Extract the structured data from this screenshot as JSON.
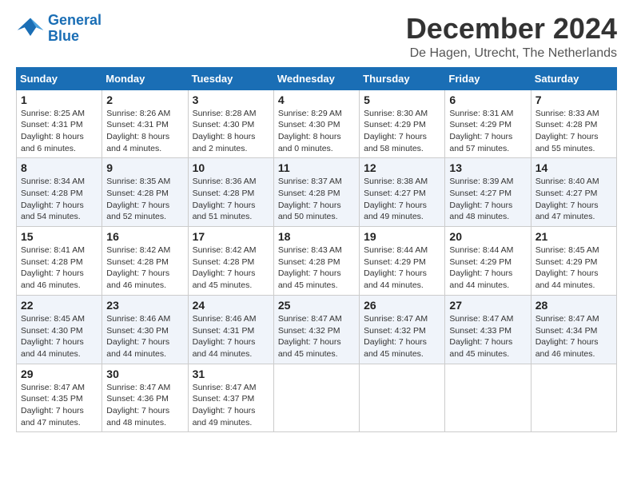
{
  "header": {
    "logo_line1": "General",
    "logo_line2": "Blue",
    "month_year": "December 2024",
    "location": "De Hagen, Utrecht, The Netherlands"
  },
  "days_of_week": [
    "Sunday",
    "Monday",
    "Tuesday",
    "Wednesday",
    "Thursday",
    "Friday",
    "Saturday"
  ],
  "weeks": [
    [
      {
        "day": "1",
        "sunrise": "8:25 AM",
        "sunset": "4:31 PM",
        "daylight": "8 hours and 6 minutes."
      },
      {
        "day": "2",
        "sunrise": "8:26 AM",
        "sunset": "4:31 PM",
        "daylight": "8 hours and 4 minutes."
      },
      {
        "day": "3",
        "sunrise": "8:28 AM",
        "sunset": "4:30 PM",
        "daylight": "8 hours and 2 minutes."
      },
      {
        "day": "4",
        "sunrise": "8:29 AM",
        "sunset": "4:30 PM",
        "daylight": "8 hours and 0 minutes."
      },
      {
        "day": "5",
        "sunrise": "8:30 AM",
        "sunset": "4:29 PM",
        "daylight": "7 hours and 58 minutes."
      },
      {
        "day": "6",
        "sunrise": "8:31 AM",
        "sunset": "4:29 PM",
        "daylight": "7 hours and 57 minutes."
      },
      {
        "day": "7",
        "sunrise": "8:33 AM",
        "sunset": "4:28 PM",
        "daylight": "7 hours and 55 minutes."
      }
    ],
    [
      {
        "day": "8",
        "sunrise": "8:34 AM",
        "sunset": "4:28 PM",
        "daylight": "7 hours and 54 minutes."
      },
      {
        "day": "9",
        "sunrise": "8:35 AM",
        "sunset": "4:28 PM",
        "daylight": "7 hours and 52 minutes."
      },
      {
        "day": "10",
        "sunrise": "8:36 AM",
        "sunset": "4:28 PM",
        "daylight": "7 hours and 51 minutes."
      },
      {
        "day": "11",
        "sunrise": "8:37 AM",
        "sunset": "4:28 PM",
        "daylight": "7 hours and 50 minutes."
      },
      {
        "day": "12",
        "sunrise": "8:38 AM",
        "sunset": "4:27 PM",
        "daylight": "7 hours and 49 minutes."
      },
      {
        "day": "13",
        "sunrise": "8:39 AM",
        "sunset": "4:27 PM",
        "daylight": "7 hours and 48 minutes."
      },
      {
        "day": "14",
        "sunrise": "8:40 AM",
        "sunset": "4:27 PM",
        "daylight": "7 hours and 47 minutes."
      }
    ],
    [
      {
        "day": "15",
        "sunrise": "8:41 AM",
        "sunset": "4:28 PM",
        "daylight": "7 hours and 46 minutes."
      },
      {
        "day": "16",
        "sunrise": "8:42 AM",
        "sunset": "4:28 PM",
        "daylight": "7 hours and 46 minutes."
      },
      {
        "day": "17",
        "sunrise": "8:42 AM",
        "sunset": "4:28 PM",
        "daylight": "7 hours and 45 minutes."
      },
      {
        "day": "18",
        "sunrise": "8:43 AM",
        "sunset": "4:28 PM",
        "daylight": "7 hours and 45 minutes."
      },
      {
        "day": "19",
        "sunrise": "8:44 AM",
        "sunset": "4:29 PM",
        "daylight": "7 hours and 44 minutes."
      },
      {
        "day": "20",
        "sunrise": "8:44 AM",
        "sunset": "4:29 PM",
        "daylight": "7 hours and 44 minutes."
      },
      {
        "day": "21",
        "sunrise": "8:45 AM",
        "sunset": "4:29 PM",
        "daylight": "7 hours and 44 minutes."
      }
    ],
    [
      {
        "day": "22",
        "sunrise": "8:45 AM",
        "sunset": "4:30 PM",
        "daylight": "7 hours and 44 minutes."
      },
      {
        "day": "23",
        "sunrise": "8:46 AM",
        "sunset": "4:30 PM",
        "daylight": "7 hours and 44 minutes."
      },
      {
        "day": "24",
        "sunrise": "8:46 AM",
        "sunset": "4:31 PM",
        "daylight": "7 hours and 44 minutes."
      },
      {
        "day": "25",
        "sunrise": "8:47 AM",
        "sunset": "4:32 PM",
        "daylight": "7 hours and 45 minutes."
      },
      {
        "day": "26",
        "sunrise": "8:47 AM",
        "sunset": "4:32 PM",
        "daylight": "7 hours and 45 minutes."
      },
      {
        "day": "27",
        "sunrise": "8:47 AM",
        "sunset": "4:33 PM",
        "daylight": "7 hours and 45 minutes."
      },
      {
        "day": "28",
        "sunrise": "8:47 AM",
        "sunset": "4:34 PM",
        "daylight": "7 hours and 46 minutes."
      }
    ],
    [
      {
        "day": "29",
        "sunrise": "8:47 AM",
        "sunset": "4:35 PM",
        "daylight": "7 hours and 47 minutes."
      },
      {
        "day": "30",
        "sunrise": "8:47 AM",
        "sunset": "4:36 PM",
        "daylight": "7 hours and 48 minutes."
      },
      {
        "day": "31",
        "sunrise": "8:47 AM",
        "sunset": "4:37 PM",
        "daylight": "7 hours and 49 minutes."
      },
      null,
      null,
      null,
      null
    ]
  ]
}
